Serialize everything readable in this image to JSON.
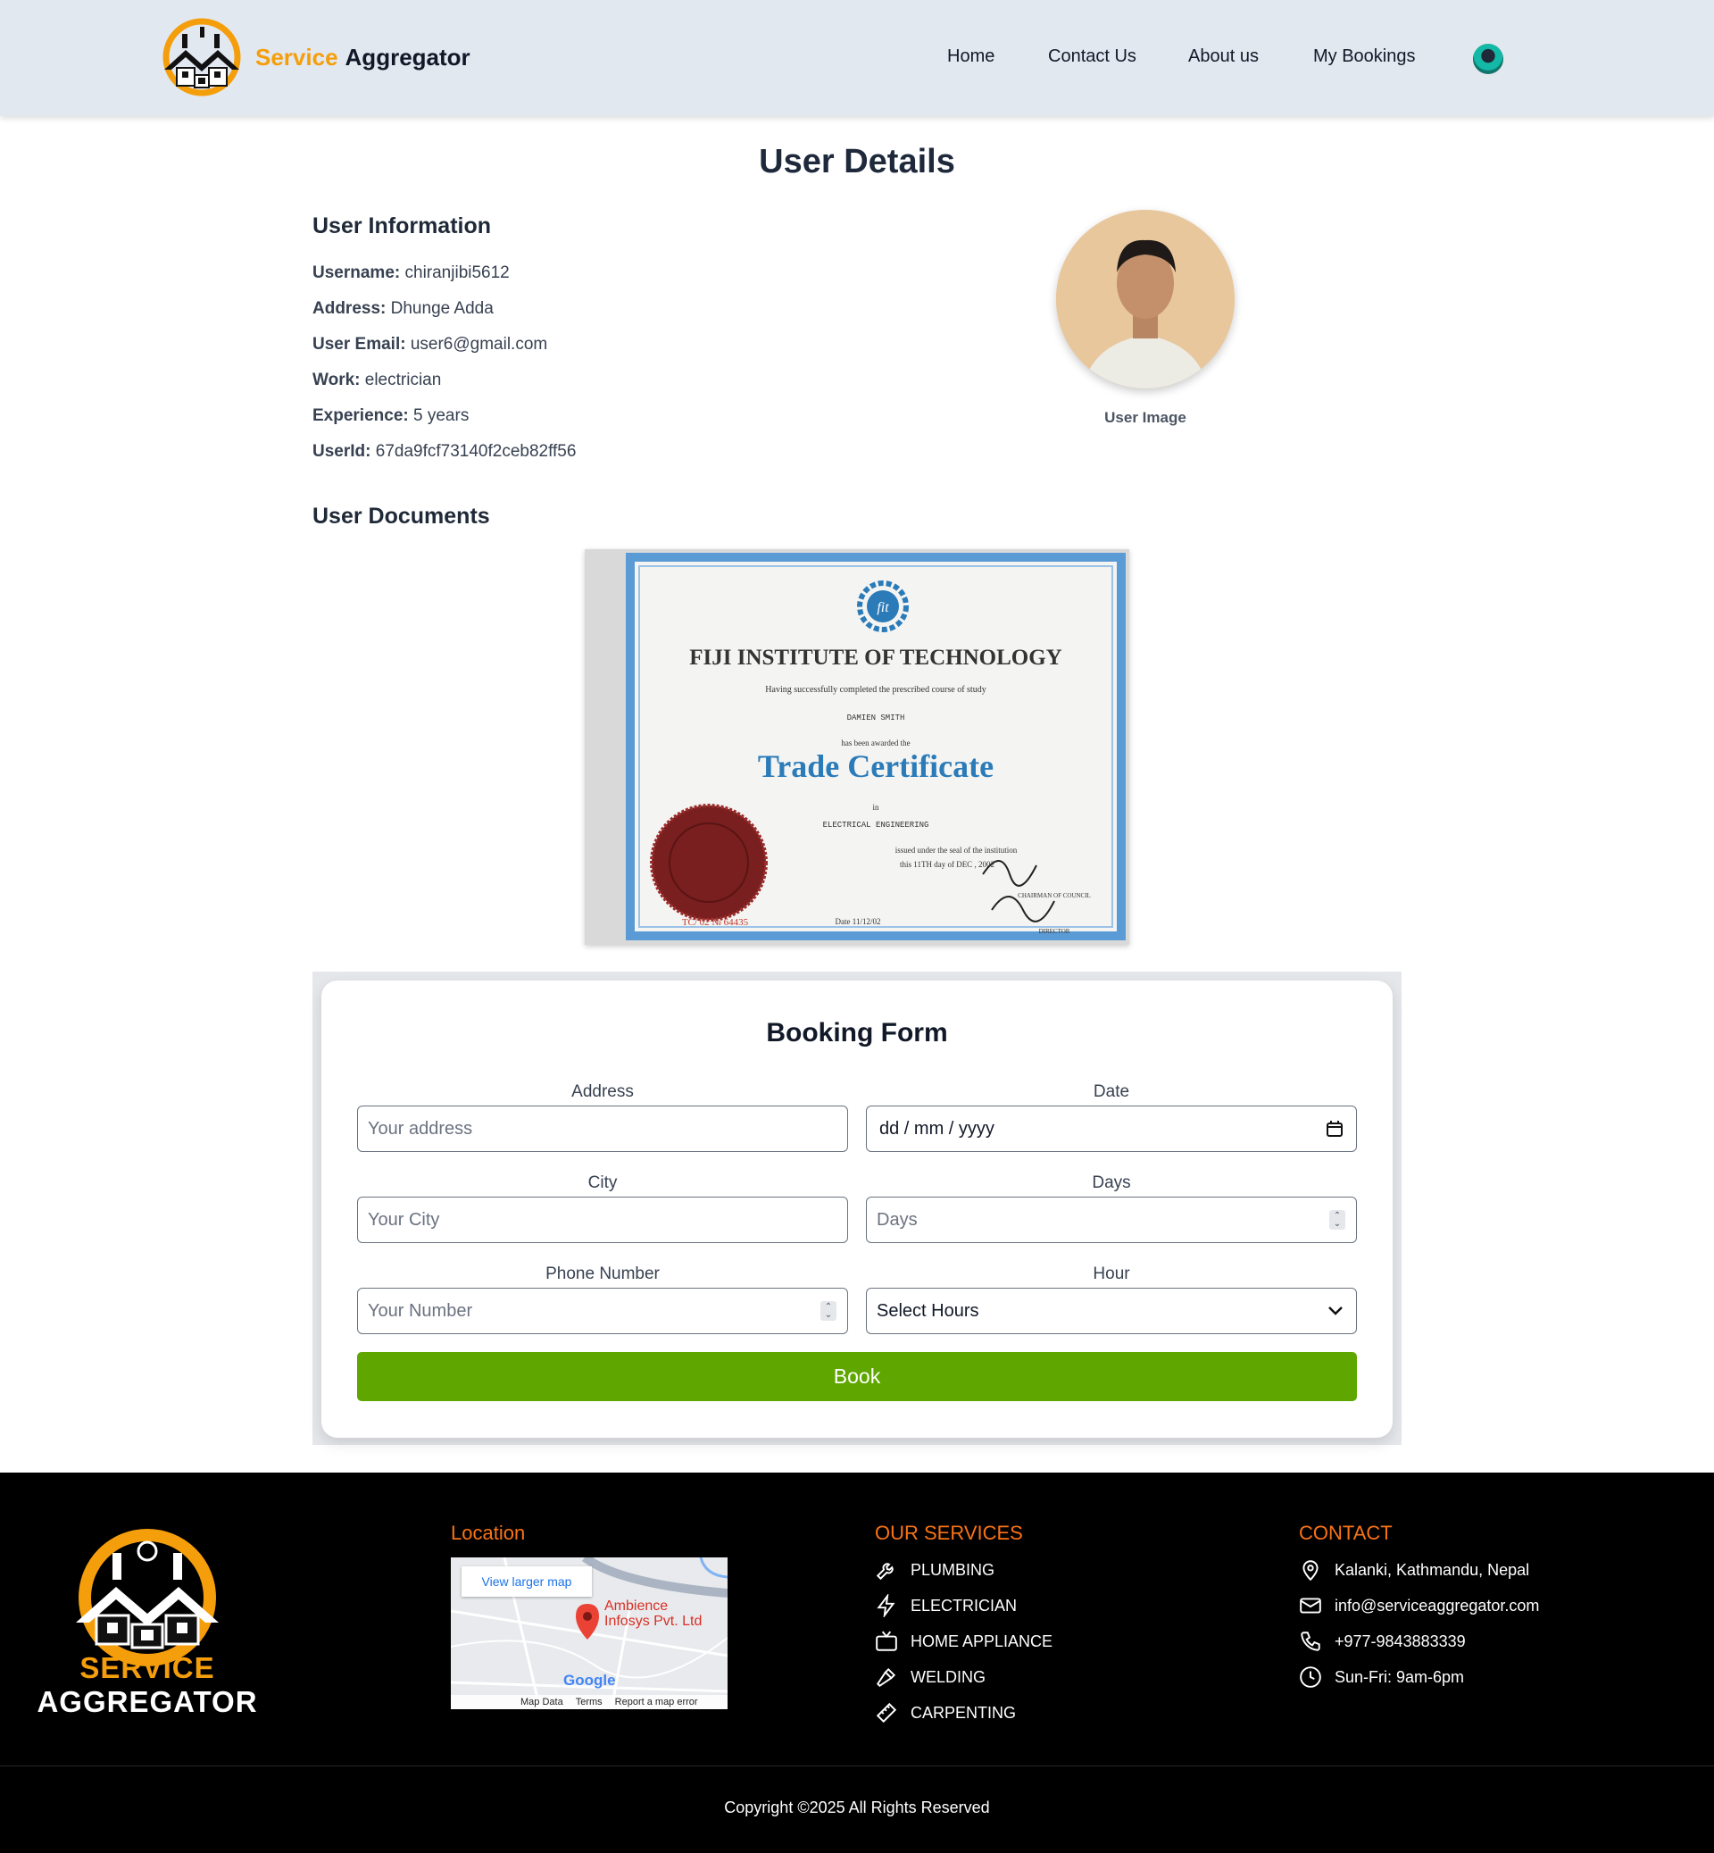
{
  "brand": {
    "part1": "Service",
    "part2": "Aggregator"
  },
  "nav": {
    "home": "Home",
    "contact": "Contact Us",
    "about": "About us",
    "bookings": "My Bookings"
  },
  "page": {
    "title": "User Details"
  },
  "user_info": {
    "heading": "User Information",
    "fields": [
      {
        "label": "Username:",
        "value": "chiranjibi5612"
      },
      {
        "label": "Address:",
        "value": "Dhunge Adda"
      },
      {
        "label": "User Email:",
        "value": "user6@gmail.com"
      },
      {
        "label": "Work:",
        "value": "electrician"
      },
      {
        "label": "Experience:",
        "value": "5 years"
      },
      {
        "label": "UserId:",
        "value": "67da9fcf73140f2ceb82ff56"
      }
    ],
    "image_label": "User Image"
  },
  "documents": {
    "heading": "User Documents",
    "certificate": {
      "institute": "FIJI INSTITUTE OF TECHNOLOGY",
      "line1": "Having successfully completed the prescribed course of study",
      "name": "DAMIEN SMITH",
      "line2": "has been awarded the",
      "title": "Trade Certificate",
      "line3": "in",
      "field": "ELECTRICAL ENGINEERING",
      "line4": "issued under the seal of the institution",
      "issue": "this 11TH day of DEC , 2002",
      "date": "Date 11/12/02",
      "serial": "TC/ 02 № 64435",
      "sign1": "CHAIRMAN OF COUNCIL",
      "sign2": "DIRECTOR"
    }
  },
  "booking": {
    "title": "Booking Form",
    "address_label": "Address",
    "address_placeholder": "Your address",
    "date_label": "Date",
    "date_placeholder": "dd / mm / yyyy",
    "city_label": "City",
    "city_placeholder": "Your City",
    "days_label": "Days",
    "days_placeholder": "Days",
    "phone_label": "Phone Number",
    "phone_placeholder": "Your Number",
    "hour_label": "Hour",
    "hour_selected": "Select Hours",
    "book_label": "Book"
  },
  "footer": {
    "brand1": "SERVICE",
    "brand2": "AGGREGATOR",
    "location_heading": "Location",
    "map": {
      "link": "View larger map",
      "place1": "Ambience",
      "place2": "Infosys Pvt. Ltd",
      "google": "Google",
      "bar": [
        "Map Data",
        "Terms",
        "Report a map error"
      ]
    },
    "services_heading": "OUR SERVICES",
    "services": [
      "PLUMBING",
      "ELECTRICIAN",
      "HOME APPLIANCE",
      "WELDING",
      "CARPENTING"
    ],
    "contact_heading": "CONTACT",
    "contact": {
      "address": "Kalanki, Kathmandu, Nepal",
      "email": "info@serviceaggregator.com",
      "phone": "+977-9843883339",
      "hours": "Sun-Fri: 9am-6pm"
    },
    "copyright": "Copyright ©2025 All Rights Reserved"
  },
  "colors": {
    "accent": "#f59e0b",
    "footer_heading": "#f97316",
    "book_button": "#5fa700",
    "header_bg": "#e2e8f0"
  }
}
